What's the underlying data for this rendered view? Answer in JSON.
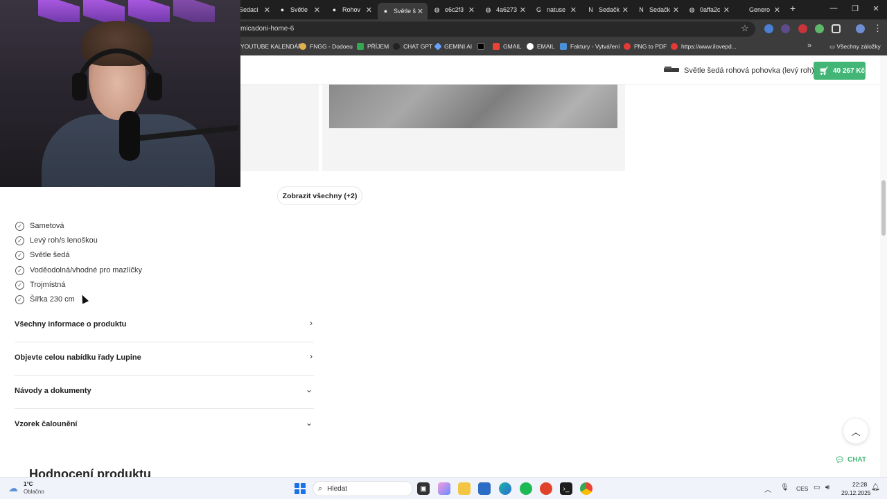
{
  "browser": {
    "tabs": [
      {
        "title": "Sedaci"
      },
      {
        "title": "Světle"
      },
      {
        "title": "Rohov"
      },
      {
        "title": "Světle š"
      },
      {
        "title": "e6c2f3"
      },
      {
        "title": "4a6273"
      },
      {
        "title": "natuse"
      },
      {
        "title": "Sedačk"
      },
      {
        "title": "Sedačk"
      },
      {
        "title": "0affa2c"
      },
      {
        "title": "Genero"
      }
    ],
    "new_tab_icon": "plus-icon",
    "url": "micadoni-home-6",
    "bookmarks": [
      {
        "label": "YOUTUBE KALENDÁŘ",
        "color": "#3c3c3c"
      },
      {
        "label": "FNGG - Dodoeu",
        "color": "#e0b04a"
      },
      {
        "label": "PŘÍJEM",
        "color": "#34a853"
      },
      {
        "label": "CHAT GPT",
        "color": "#222222"
      },
      {
        "label": "GEMINI AI",
        "color": "#6aa0ff"
      },
      {
        "label": "",
        "color": "#000000"
      },
      {
        "label": "GMAIL",
        "color": "#ea4335"
      },
      {
        "label": "EMAIL",
        "color": "#ffffff"
      },
      {
        "label": "Faktury - Vytváření",
        "color": "#4a90d9"
      },
      {
        "label": "PNG to PDF",
        "color": "#e53935"
      },
      {
        "label": "https://www.ilovepd...",
        "color": "#e53935"
      }
    ],
    "all_bookmarks": "Všechny záložky"
  },
  "page": {
    "sticky": {
      "product_name": "Světle šedá rohová pohovka (levý roh) ...",
      "price": "40 267 Kč"
    },
    "show_all_button": "Zobrazit všechny (+2)",
    "features": [
      "Sametová",
      "Levý roh/s lenoškou",
      "Světle šedá",
      "Voděodolná/vhodné pro mazlíčky",
      "Trojmístná",
      "Šířka 230 cm"
    ],
    "accordions": [
      {
        "label": "Všechny informace o produktu",
        "icon": "chevron-right-icon"
      },
      {
        "label": "Objevte celou nabídku řady Lupine",
        "icon": "chevron-right-icon"
      },
      {
        "label": "Návody a dokumenty",
        "icon": "chevron-down-icon"
      },
      {
        "label": "Vzorek čalounění",
        "icon": "chevron-down-icon"
      }
    ],
    "reviews_heading": "Hodnocení produktu",
    "chat_label": "CHAT",
    "accent_color": "#43b677"
  },
  "taskbar": {
    "weather_temp": "1°C",
    "weather_desc": "Oblačno",
    "search_placeholder": "Hledat",
    "lang": "CES",
    "time": "22:28",
    "date": "29.12.2025"
  }
}
